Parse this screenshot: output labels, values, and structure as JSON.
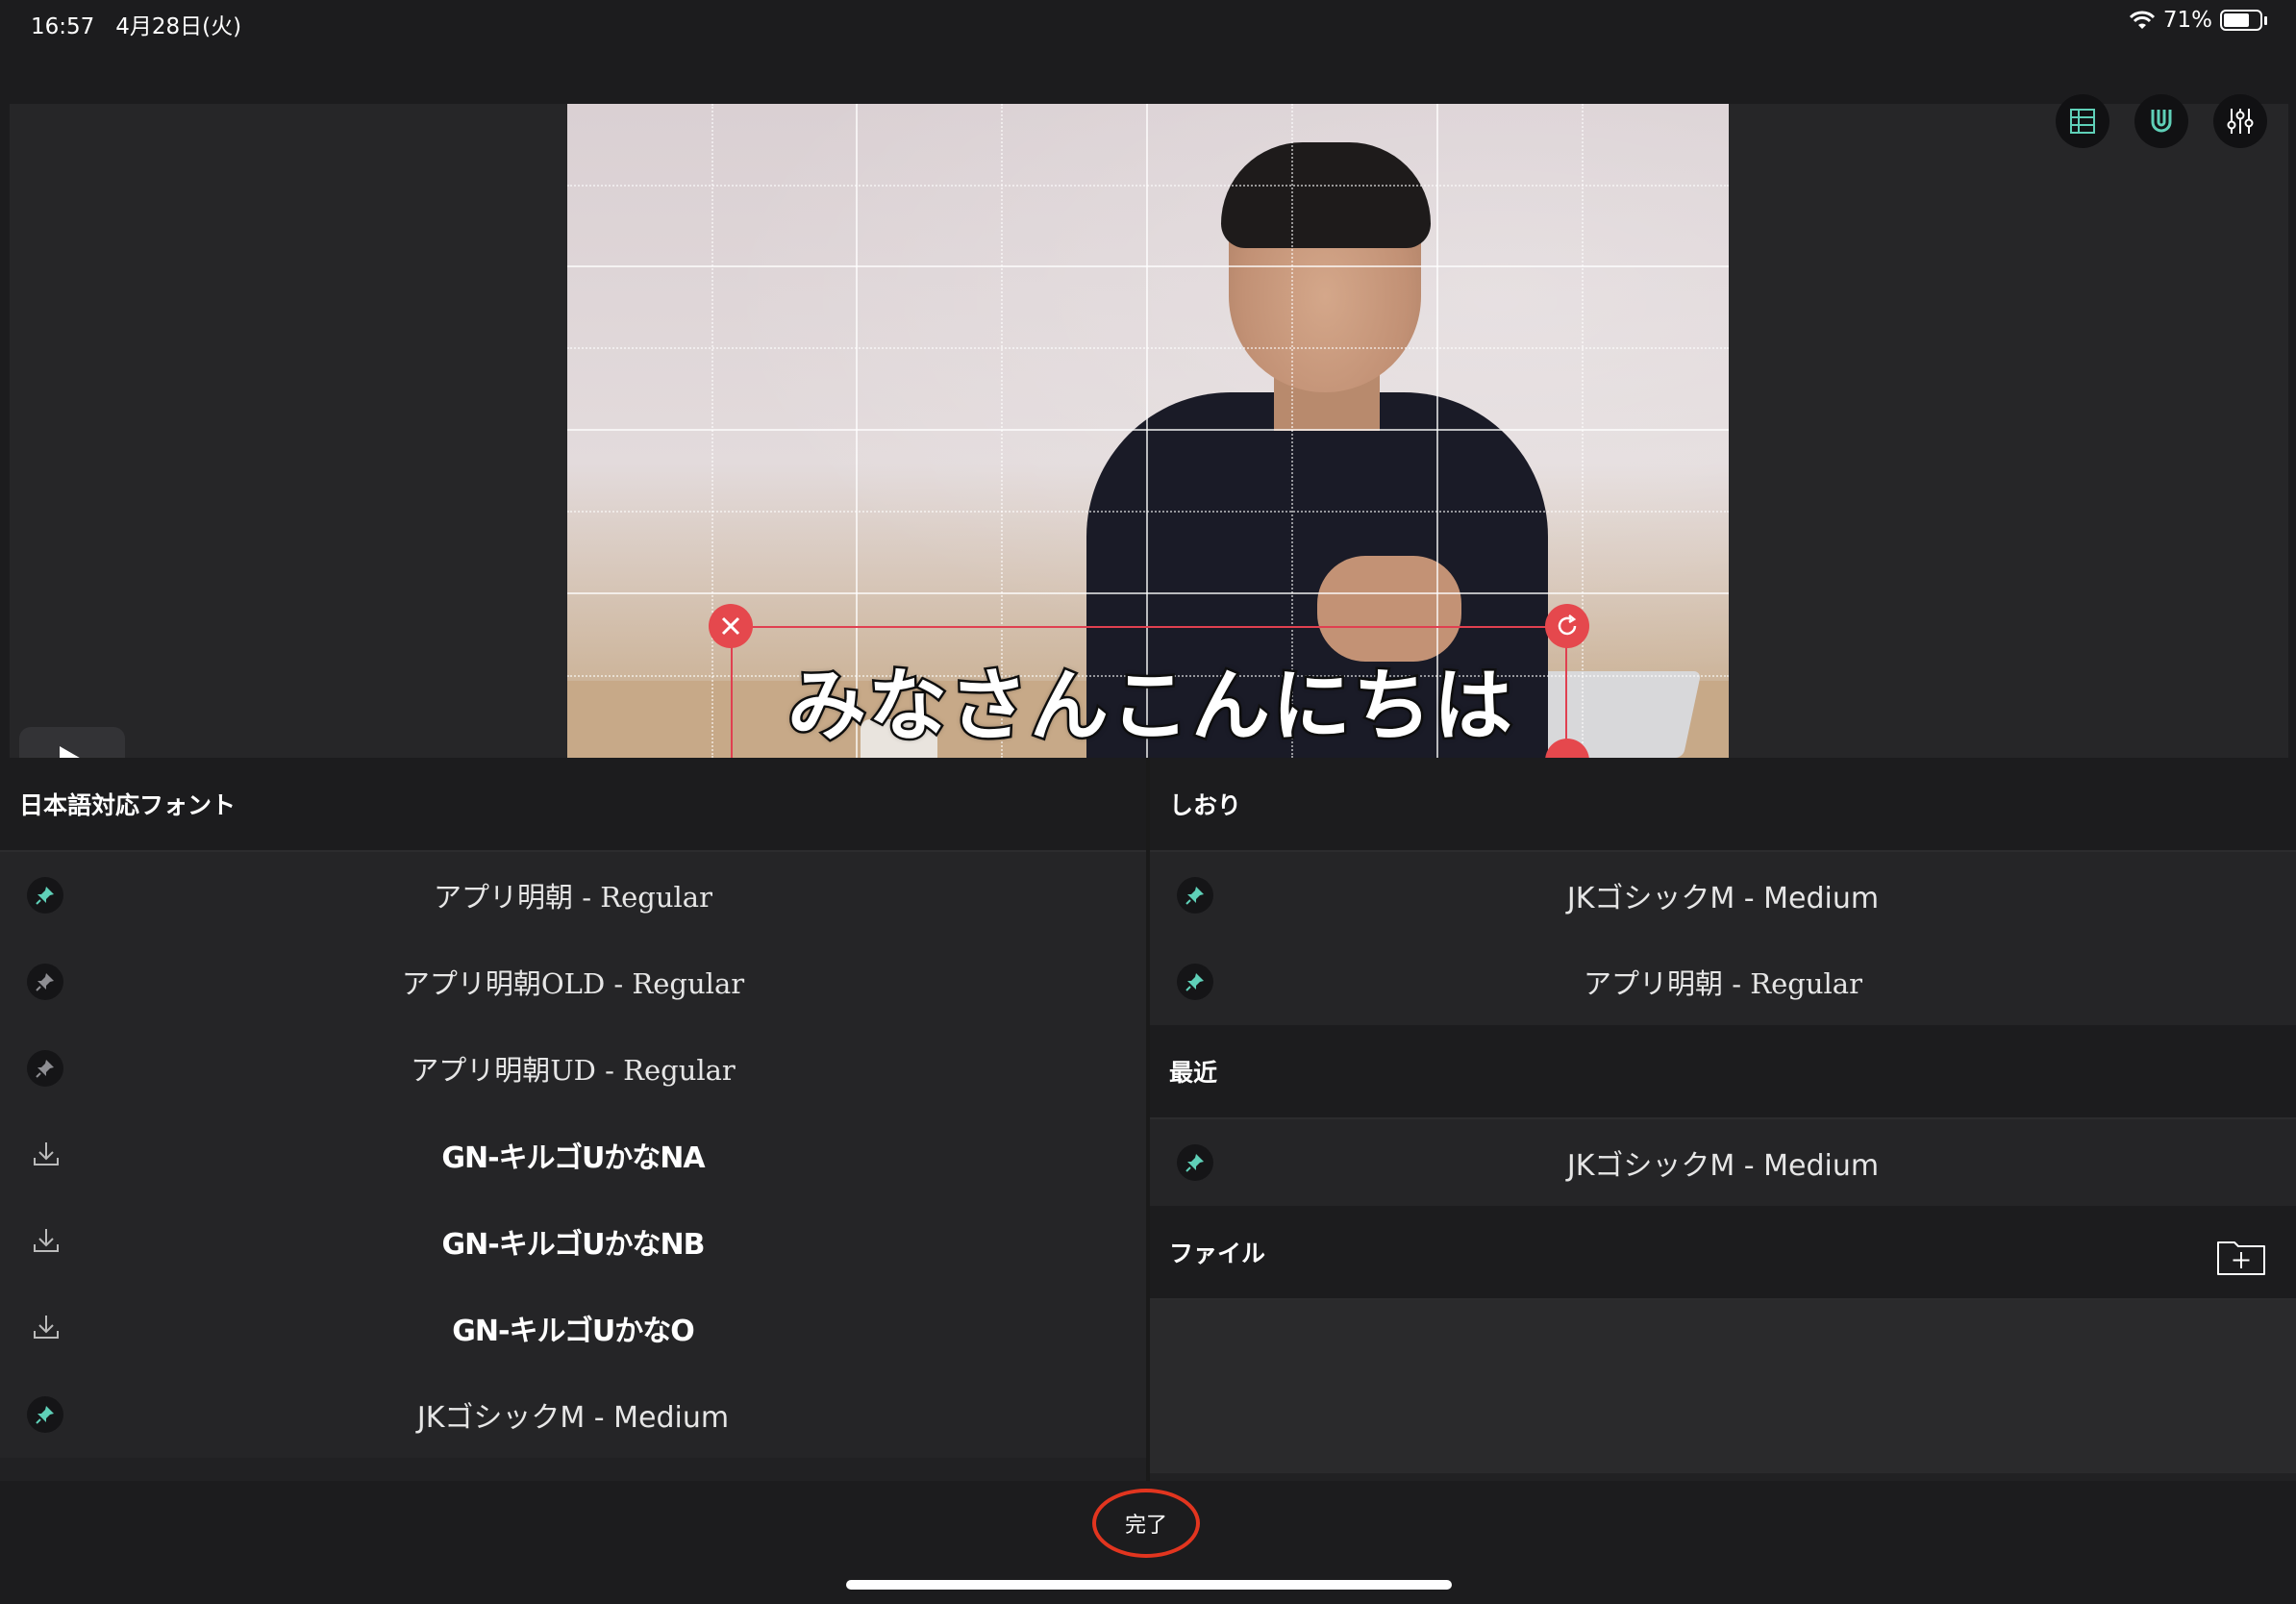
{
  "status_bar": {
    "time": "16:57",
    "date": "4月28日(火)",
    "battery": "71%",
    "battery_level": 0.71
  },
  "toolbar": {
    "icons": [
      "grid-icon",
      "magnet-icon",
      "sliders-icon"
    ]
  },
  "preview": {
    "caption_text": "みなさんこんにちは"
  },
  "left_panel": {
    "header": "日本語対応フォント",
    "fonts": [
      {
        "name": "アプリ明朝 - Regular",
        "status": "pinned",
        "style": "serif"
      },
      {
        "name": "アプリ明朝OLD - Regular",
        "status": "unpinned",
        "style": "serif"
      },
      {
        "name": "アプリ明朝UD - Regular",
        "status": "unpinned",
        "style": "serif"
      },
      {
        "name": "GN-キルゴUかなNA",
        "status": "download",
        "style": "heavy"
      },
      {
        "name": "GN-キルゴUかなNB",
        "status": "download",
        "style": "heavy"
      },
      {
        "name": "GN-キルゴUかなO",
        "status": "download",
        "style": "heavy"
      },
      {
        "name": "JKゴシックM - Medium",
        "status": "pinned",
        "style": "sans"
      }
    ]
  },
  "right_panel": {
    "bookmarks": {
      "header": "しおり",
      "fonts": [
        {
          "name": "JKゴシックM - Medium",
          "status": "pinned",
          "style": "sans"
        },
        {
          "name": "アプリ明朝 - Regular",
          "status": "pinned",
          "style": "serif"
        }
      ]
    },
    "recent": {
      "header": "最近",
      "fonts": [
        {
          "name": "JKゴシックM - Medium",
          "status": "pinned",
          "style": "sans"
        }
      ]
    },
    "files": {
      "header": "ファイル"
    }
  },
  "bottom": {
    "done_label": "完了"
  },
  "colors": {
    "accent_pin": "#5fd0b8",
    "delete_handle": "#e5484d",
    "highlight_circle": "#e2351f"
  }
}
